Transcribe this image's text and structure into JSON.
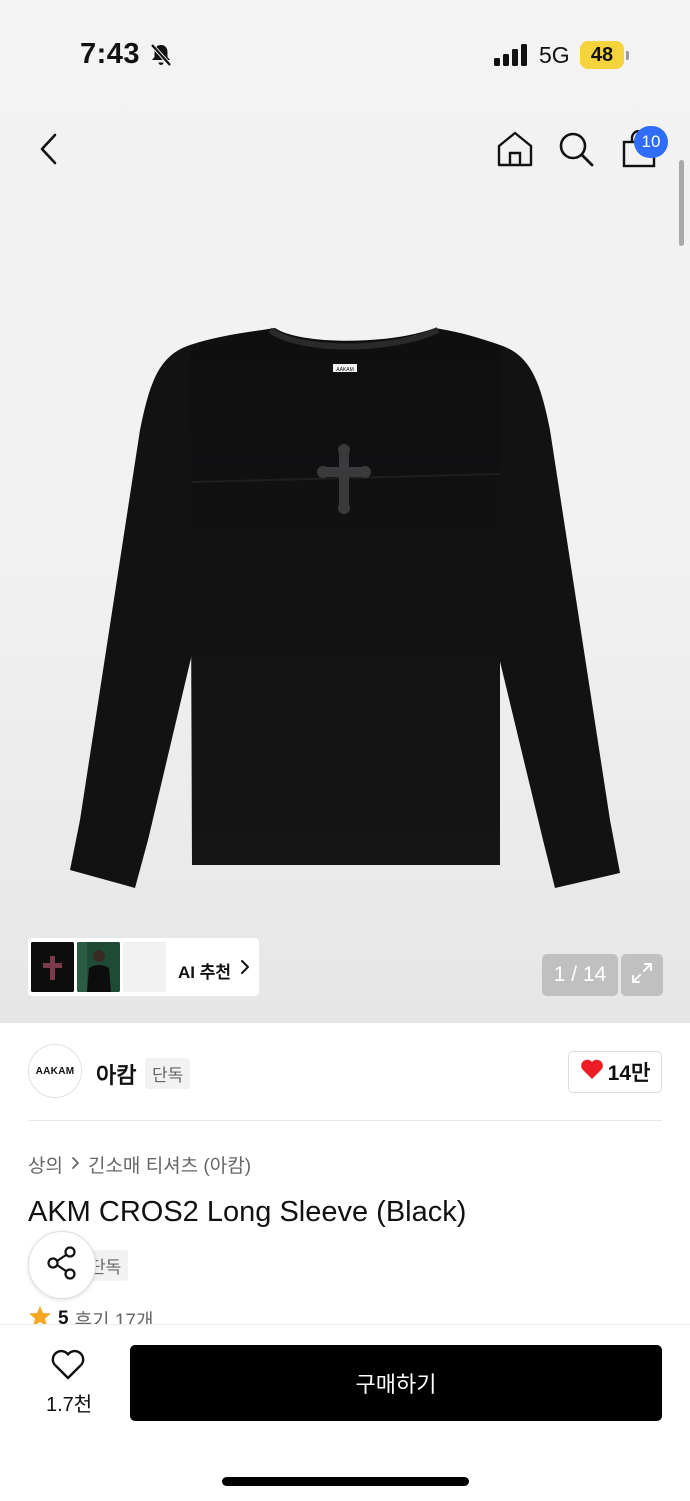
{
  "status_bar": {
    "time": "7:43",
    "network": "5G",
    "battery": "48",
    "battery_color": "#f4d33c"
  },
  "nav": {
    "back_icon": "chevron-left-icon",
    "home_icon": "home-icon",
    "search_icon": "search-icon",
    "cart_icon": "shopping-bag-icon",
    "cart_count": "10",
    "badge_color": "#2f6df6"
  },
  "gallery": {
    "ai_recommend_label": "AI 추천",
    "image_counter": "1 / 14",
    "product_print_text": "AAKAM"
  },
  "brand": {
    "logo_text": "AAKAM",
    "name": "아캄",
    "exclusive_tag": "단독",
    "like_count": "14만"
  },
  "product": {
    "category": "상의",
    "subcategory": "긴소매 티셔츠 (아캄)",
    "title": "AKM CROS2 Long Sleeve (Black)",
    "exclusive_tag": "단독",
    "rating": "5",
    "reviews": "후기 17개"
  },
  "bottom": {
    "wish_count": "1.7천",
    "buy_label": "구매하기"
  }
}
